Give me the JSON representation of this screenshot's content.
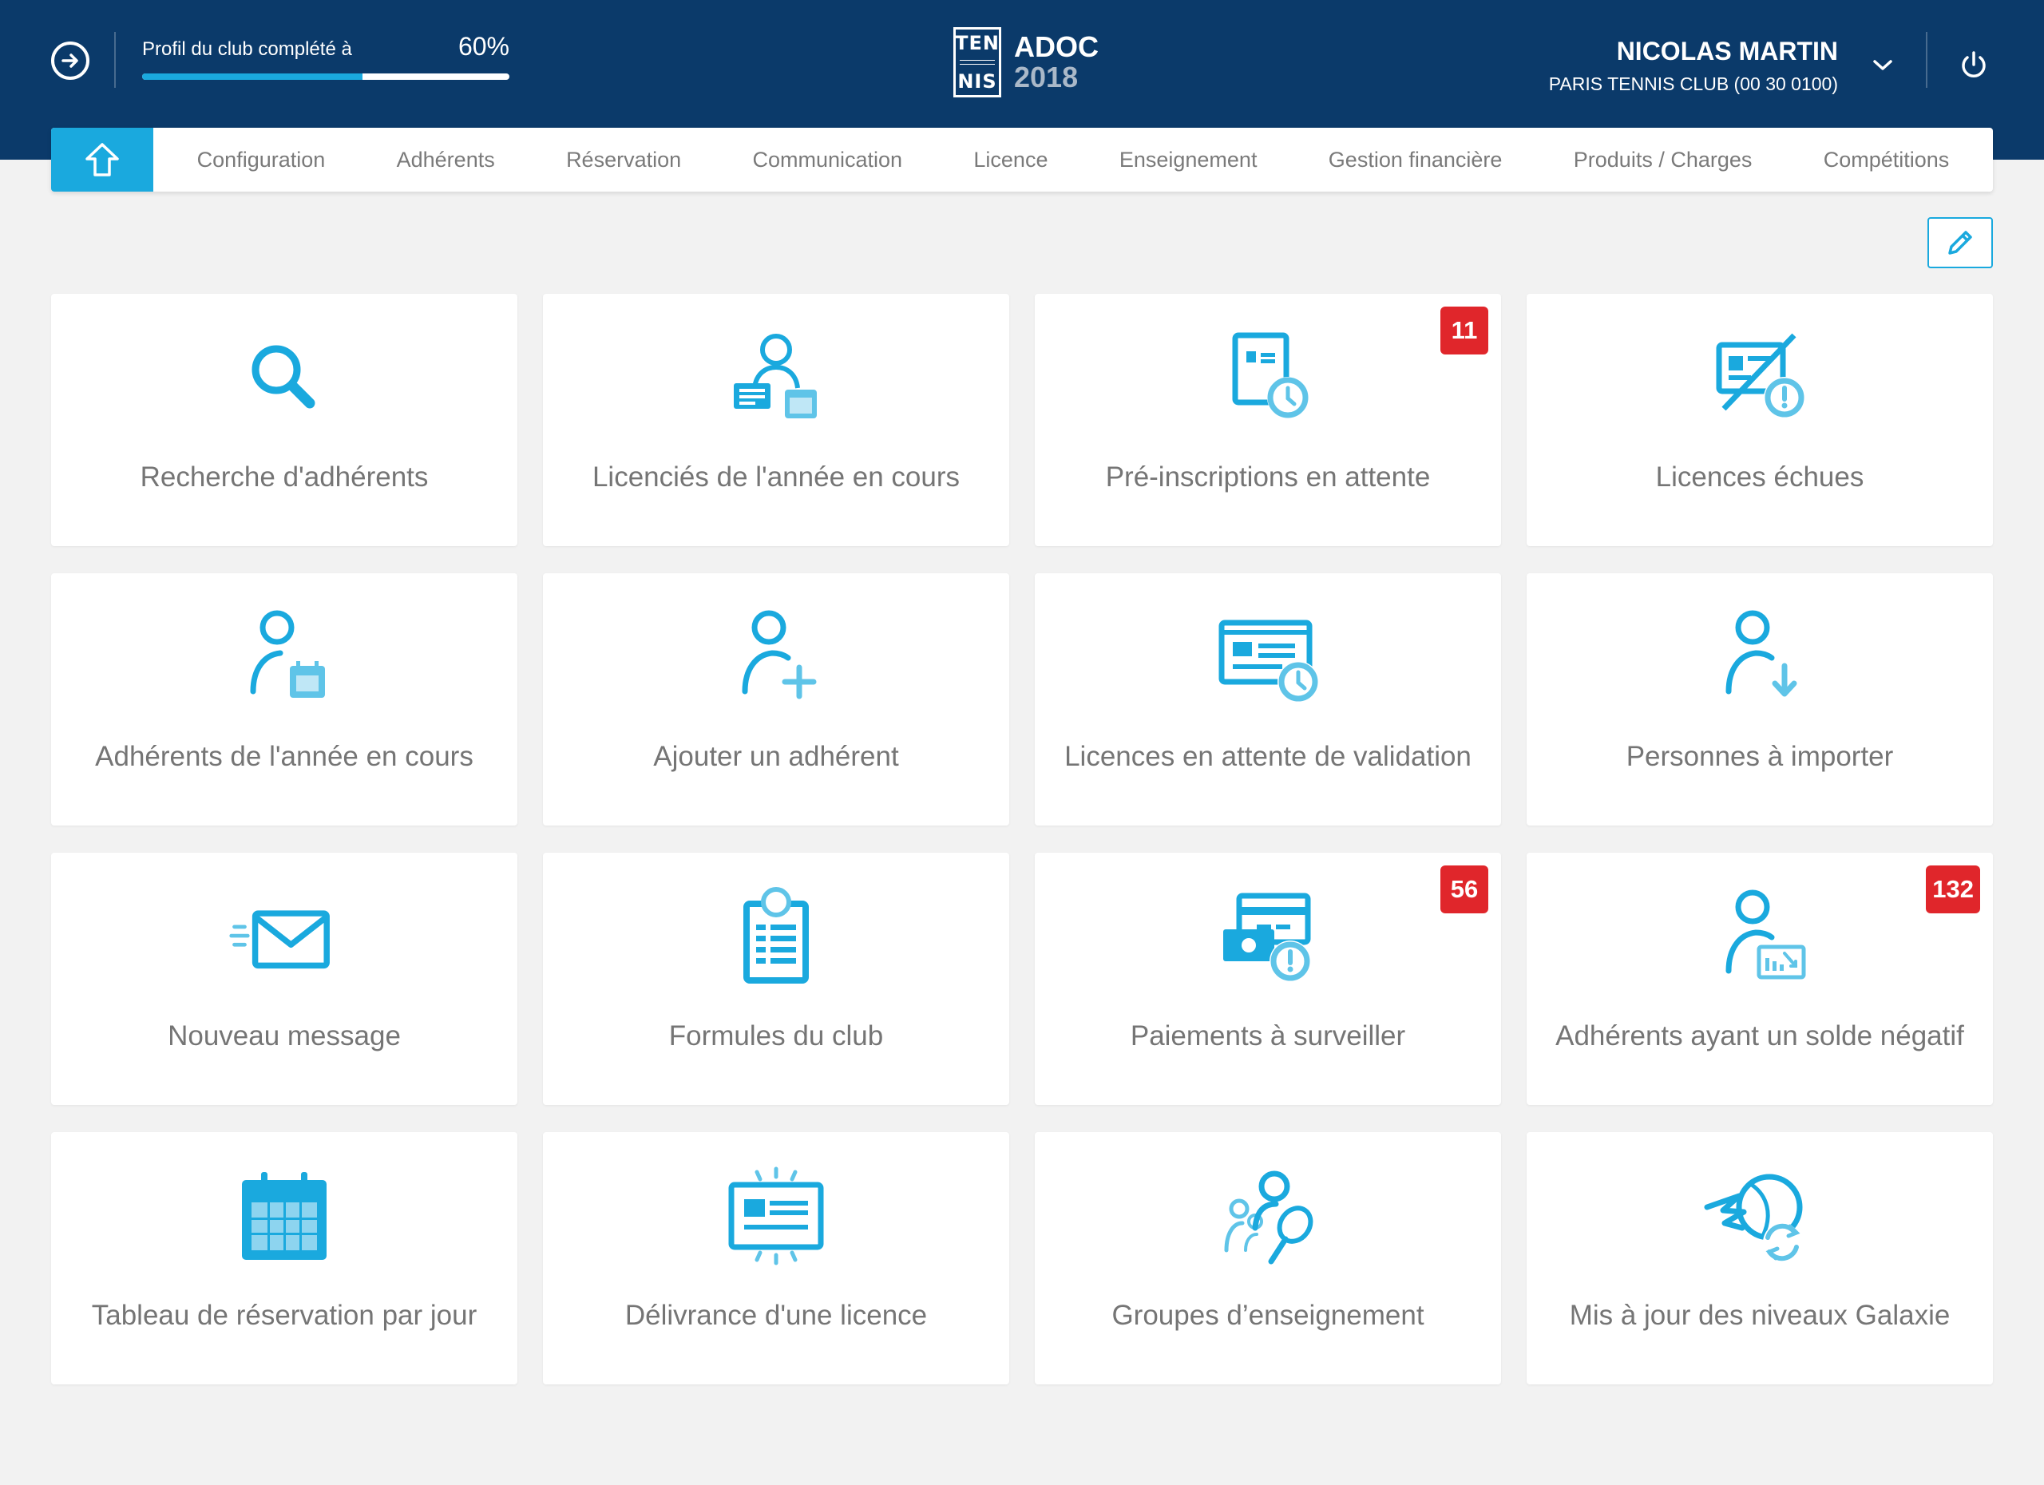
{
  "header": {
    "profile_label": "Profil du club complété à",
    "profile_percent": "60%",
    "profile_progress": 0.6,
    "logo": {
      "mark_top": "TEN",
      "mark_bottom": "NIS",
      "title": "ADOC",
      "year": "2018"
    },
    "user_name": "NICOLAS MARTIN",
    "user_club": "PARIS TENNIS CLUB (00 30 0100)"
  },
  "nav": {
    "home_icon": "home-icon",
    "items": [
      "Configuration",
      "Adhérents",
      "Réservation",
      "Communication",
      "Licence",
      "Enseignement",
      "Gestion financière",
      "Produits / Charges",
      "Compétitions"
    ]
  },
  "colors": {
    "header_bg": "#0b3a6a",
    "accent": "#1aa9de",
    "badge": "#e0262b",
    "page_bg": "#f2f2f2"
  },
  "tiles": [
    {
      "label": "Recherche d'adhérents",
      "icon": "search-icon",
      "badge": ""
    },
    {
      "label": "Licenciés de l'année en cours",
      "icon": "licensed-members-icon",
      "badge": ""
    },
    {
      "label": "Pré-inscriptions en attente",
      "icon": "pending-preregistration-icon",
      "badge": "11"
    },
    {
      "label": "Licences échues",
      "icon": "expired-licence-icon",
      "badge": ""
    },
    {
      "label": "Adhérents de l'année en cours",
      "icon": "member-calendar-icon",
      "badge": ""
    },
    {
      "label": "Ajouter un adhérent",
      "icon": "add-user-icon",
      "badge": ""
    },
    {
      "label": "Licences en attente de validation",
      "icon": "licence-pending-icon",
      "badge": ""
    },
    {
      "label": "Personnes à importer",
      "icon": "import-user-icon",
      "badge": ""
    },
    {
      "label": "Nouveau message",
      "icon": "envelope-icon",
      "badge": ""
    },
    {
      "label": "Formules du club",
      "icon": "clipboard-icon",
      "badge": ""
    },
    {
      "label": "Paiements à surveiller",
      "icon": "payment-alert-icon",
      "badge": "56"
    },
    {
      "label": "Adhérents ayant un solde négatif",
      "icon": "negative-balance-icon",
      "badge": "132"
    },
    {
      "label": "Tableau de réservation par jour",
      "icon": "calendar-icon",
      "badge": ""
    },
    {
      "label": "Délivrance d'une licence",
      "icon": "licence-card-icon",
      "badge": ""
    },
    {
      "label": "Groupes d’enseignement",
      "icon": "teaching-group-icon",
      "badge": ""
    },
    {
      "label": "Mis à jour des niveaux Galaxie",
      "icon": "galaxie-update-icon",
      "badge": ""
    }
  ]
}
